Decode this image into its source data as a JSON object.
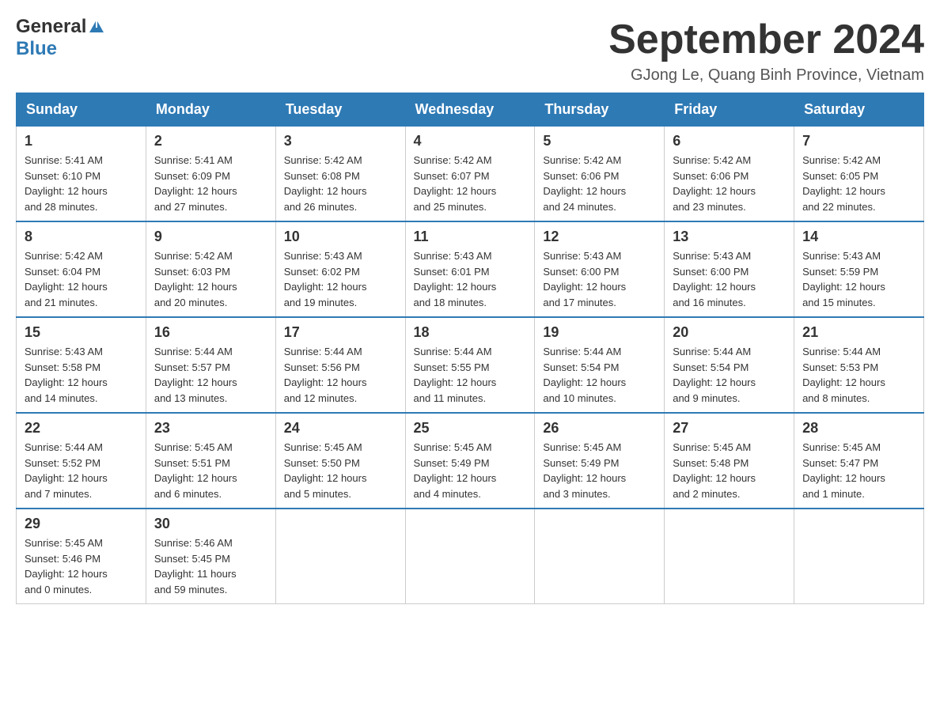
{
  "header": {
    "logo_general": "General",
    "logo_blue": "Blue",
    "month_year": "September 2024",
    "location": "GJong Le, Quang Binh Province, Vietnam"
  },
  "days_of_week": [
    "Sunday",
    "Monday",
    "Tuesday",
    "Wednesday",
    "Thursday",
    "Friday",
    "Saturday"
  ],
  "weeks": [
    [
      {
        "day": "1",
        "sunrise": "5:41 AM",
        "sunset": "6:10 PM",
        "daylight": "12 hours and 28 minutes."
      },
      {
        "day": "2",
        "sunrise": "5:41 AM",
        "sunset": "6:09 PM",
        "daylight": "12 hours and 27 minutes."
      },
      {
        "day": "3",
        "sunrise": "5:42 AM",
        "sunset": "6:08 PM",
        "daylight": "12 hours and 26 minutes."
      },
      {
        "day": "4",
        "sunrise": "5:42 AM",
        "sunset": "6:07 PM",
        "daylight": "12 hours and 25 minutes."
      },
      {
        "day": "5",
        "sunrise": "5:42 AM",
        "sunset": "6:06 PM",
        "daylight": "12 hours and 24 minutes."
      },
      {
        "day": "6",
        "sunrise": "5:42 AM",
        "sunset": "6:06 PM",
        "daylight": "12 hours and 23 minutes."
      },
      {
        "day": "7",
        "sunrise": "5:42 AM",
        "sunset": "6:05 PM",
        "daylight": "12 hours and 22 minutes."
      }
    ],
    [
      {
        "day": "8",
        "sunrise": "5:42 AM",
        "sunset": "6:04 PM",
        "daylight": "12 hours and 21 minutes."
      },
      {
        "day": "9",
        "sunrise": "5:42 AM",
        "sunset": "6:03 PM",
        "daylight": "12 hours and 20 minutes."
      },
      {
        "day": "10",
        "sunrise": "5:43 AM",
        "sunset": "6:02 PM",
        "daylight": "12 hours and 19 minutes."
      },
      {
        "day": "11",
        "sunrise": "5:43 AM",
        "sunset": "6:01 PM",
        "daylight": "12 hours and 18 minutes."
      },
      {
        "day": "12",
        "sunrise": "5:43 AM",
        "sunset": "6:00 PM",
        "daylight": "12 hours and 17 minutes."
      },
      {
        "day": "13",
        "sunrise": "5:43 AM",
        "sunset": "6:00 PM",
        "daylight": "12 hours and 16 minutes."
      },
      {
        "day": "14",
        "sunrise": "5:43 AM",
        "sunset": "5:59 PM",
        "daylight": "12 hours and 15 minutes."
      }
    ],
    [
      {
        "day": "15",
        "sunrise": "5:43 AM",
        "sunset": "5:58 PM",
        "daylight": "12 hours and 14 minutes."
      },
      {
        "day": "16",
        "sunrise": "5:44 AM",
        "sunset": "5:57 PM",
        "daylight": "12 hours and 13 minutes."
      },
      {
        "day": "17",
        "sunrise": "5:44 AM",
        "sunset": "5:56 PM",
        "daylight": "12 hours and 12 minutes."
      },
      {
        "day": "18",
        "sunrise": "5:44 AM",
        "sunset": "5:55 PM",
        "daylight": "12 hours and 11 minutes."
      },
      {
        "day": "19",
        "sunrise": "5:44 AM",
        "sunset": "5:54 PM",
        "daylight": "12 hours and 10 minutes."
      },
      {
        "day": "20",
        "sunrise": "5:44 AM",
        "sunset": "5:54 PM",
        "daylight": "12 hours and 9 minutes."
      },
      {
        "day": "21",
        "sunrise": "5:44 AM",
        "sunset": "5:53 PM",
        "daylight": "12 hours and 8 minutes."
      }
    ],
    [
      {
        "day": "22",
        "sunrise": "5:44 AM",
        "sunset": "5:52 PM",
        "daylight": "12 hours and 7 minutes."
      },
      {
        "day": "23",
        "sunrise": "5:45 AM",
        "sunset": "5:51 PM",
        "daylight": "12 hours and 6 minutes."
      },
      {
        "day": "24",
        "sunrise": "5:45 AM",
        "sunset": "5:50 PM",
        "daylight": "12 hours and 5 minutes."
      },
      {
        "day": "25",
        "sunrise": "5:45 AM",
        "sunset": "5:49 PM",
        "daylight": "12 hours and 4 minutes."
      },
      {
        "day": "26",
        "sunrise": "5:45 AM",
        "sunset": "5:49 PM",
        "daylight": "12 hours and 3 minutes."
      },
      {
        "day": "27",
        "sunrise": "5:45 AM",
        "sunset": "5:48 PM",
        "daylight": "12 hours and 2 minutes."
      },
      {
        "day": "28",
        "sunrise": "5:45 AM",
        "sunset": "5:47 PM",
        "daylight": "12 hours and 1 minute."
      }
    ],
    [
      {
        "day": "29",
        "sunrise": "5:45 AM",
        "sunset": "5:46 PM",
        "daylight": "12 hours and 0 minutes."
      },
      {
        "day": "30",
        "sunrise": "5:46 AM",
        "sunset": "5:45 PM",
        "daylight": "11 hours and 59 minutes."
      },
      null,
      null,
      null,
      null,
      null
    ]
  ],
  "labels": {
    "sunrise_prefix": "Sunrise: ",
    "sunset_prefix": "Sunset: ",
    "daylight_prefix": "Daylight: "
  }
}
